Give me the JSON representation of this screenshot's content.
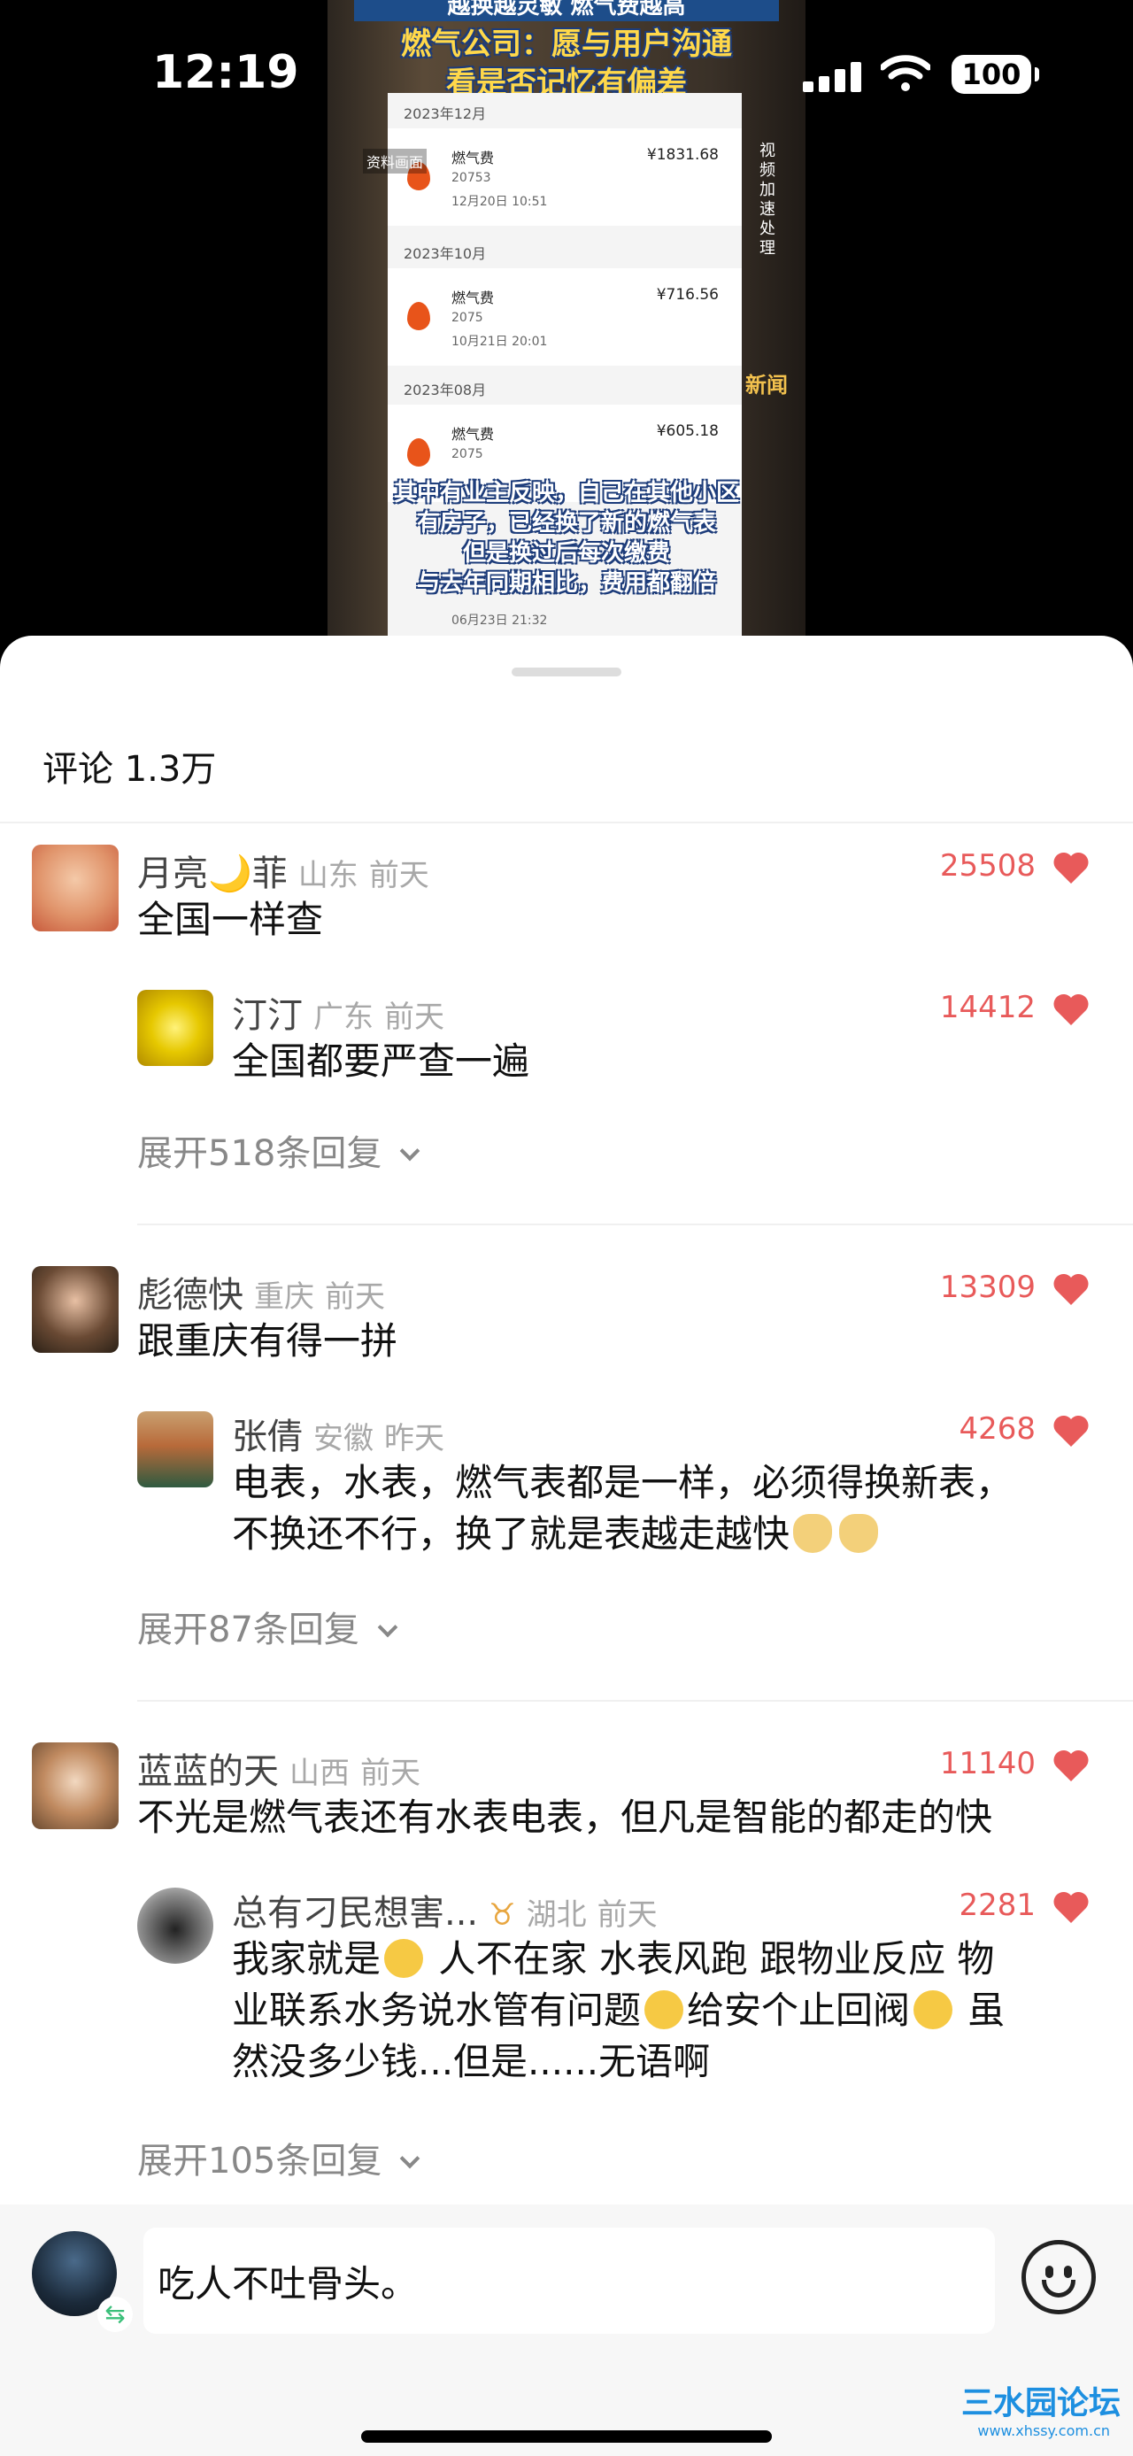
{
  "status_bar": {
    "time": "12:19",
    "battery": "100"
  },
  "video": {
    "headline_top": "越换越灵敏 燃气费越高",
    "headline_lines": [
      "燃气公司：愿与用户沟通",
      "看是否记忆有偏差"
    ],
    "side_label": "资料画面",
    "side_vertical": "视频加速处理",
    "news_tag": "新闻",
    "bills": [
      {
        "month": "2023年12月",
        "title": "燃气费",
        "amount": "¥1831.68",
        "account": "20753",
        "date": "12月20日 10:51"
      },
      {
        "month": "2023年10月",
        "title": "燃气费",
        "amount": "¥716.56",
        "account": "2075",
        "date": "10月21日 20:01"
      },
      {
        "month": "2023年08月",
        "title": "燃气费",
        "amount": "¥605.18",
        "account": "2075",
        "date": ""
      }
    ],
    "subtitle_lines": [
      "其中有业主反映，自己在其他小区",
      "有房子，已经换了新的燃气表",
      "但是换过后每次缴费",
      "与去年同期相比，费用都翻倍"
    ],
    "bottom_date": "06月23日 21:32"
  },
  "comments": {
    "header": "评论 1.3万",
    "threads": [
      {
        "name": "月亮🌙菲",
        "location": "山东",
        "time": "前天",
        "likes": "25508",
        "text": "全国一样查",
        "reply": {
          "name": "汀汀",
          "location": "广东",
          "time": "前天",
          "likes": "14412",
          "text": "全国都要严查一遍"
        },
        "expand": "展开518条回复"
      },
      {
        "name": "彪德快",
        "location": "重庆",
        "time": "前天",
        "likes": "13309",
        "text": "跟重庆有得一拼",
        "reply": {
          "name": "张倩",
          "location": "安徽",
          "time": "昨天",
          "likes": "4268",
          "text_lines": [
            "电表，水表，燃气表都是一样，必须得换新表，",
            "不换还不行，换了就是表越走越快"
          ]
        },
        "expand": "展开87条回复"
      },
      {
        "name": "蓝蓝的天",
        "location": "山西",
        "time": "前天",
        "likes": "11140",
        "text": "不光是燃气表还有水表电表，但凡是智能的都走的快",
        "reply": {
          "name": "总有刁民想害...",
          "location": "湖北",
          "time": "前天",
          "likes": "2281",
          "text_parts": [
            "我家就是",
            " 人不在家 水表风跑  跟物业反应 物",
            "业联系水务说水管有问题",
            "给安个止回阀",
            "  虽",
            "然没多少钱...但是......无语啊"
          ]
        },
        "expand": "展开105条回复"
      }
    ]
  },
  "input_bar": {
    "text": "吃人不吐骨头。",
    "swap_glyph": "⇆"
  },
  "watermark": {
    "main": "三水园论坛",
    "url": "www.xhssy.com.cn"
  },
  "colors": {
    "like_red": "#e85a5a",
    "accent_blue": "#1d8fe0"
  }
}
